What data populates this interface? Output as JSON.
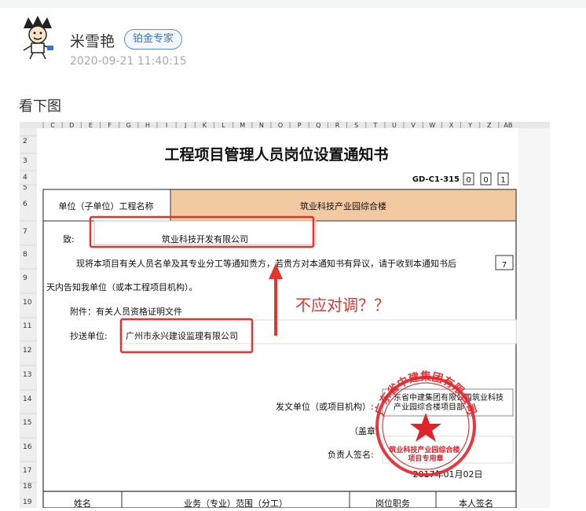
{
  "post": {
    "username": "米雪艳",
    "badge": "铂金专家",
    "timestamp": "2020-09-21 11:40:15",
    "text": "看下图"
  },
  "sheet": {
    "col_headers": [
      "C",
      "D",
      "E",
      "F",
      "G",
      "H",
      "I",
      "J",
      "K",
      "L",
      "M",
      "N",
      "O",
      "P",
      "Q",
      "R",
      "S",
      "T",
      "U",
      "V",
      "W",
      "X",
      "Y",
      "Z",
      "AB"
    ],
    "row_numbers": [
      "2",
      "3",
      "4",
      "5",
      "6",
      "7",
      "8",
      "9",
      "10",
      "11",
      "12",
      "13",
      "14",
      "15",
      "16",
      "17",
      "18",
      "19"
    ],
    "title": "工程项目管理人员岗位设置通知书",
    "code_label": "GD-C1-315",
    "code_boxes": [
      "0",
      "0",
      "1"
    ],
    "unit_label": "单位（子单位）工程名称",
    "unit_value": "筑业科技产业园综合楼",
    "to_label": "致:",
    "to_value": "筑业科技开发有限公司",
    "body_line1": "现将本项目有关人员名单及其专业分工等通知贵方，若贵方对本通知书有异议，请于收到本通知书后",
    "body_days": "7",
    "body_line2": "天内告知我单位（或本工程项目机构）。",
    "attachment": "附件：有关人员资格证明文件",
    "cc_label": "抄送单位:",
    "cc_value": "广州市永兴建设监理有限公司",
    "issuer_label": "发文单位（或项目机构）:",
    "issuer_value": "广东省中建集团有限公司筑业科技产业园综合楼项目部",
    "seal_label": "（盖章）",
    "person_label": "负责人签名:",
    "date_value": "2017年01月02日",
    "stamp_outer_text": "广东省中建集团有限公司",
    "stamp_inner_text": "筑业科技产业园综合楼项目专用章",
    "table_headers": [
      "姓名",
      "业务（专业）范围（分工）",
      "岗位职务",
      "本人签名"
    ]
  },
  "annotation": {
    "text": "不应对调？？"
  },
  "colors": {
    "header_fill": "#f3c9a2",
    "annotation": "#e8332c",
    "stamp": "#e0242a"
  }
}
